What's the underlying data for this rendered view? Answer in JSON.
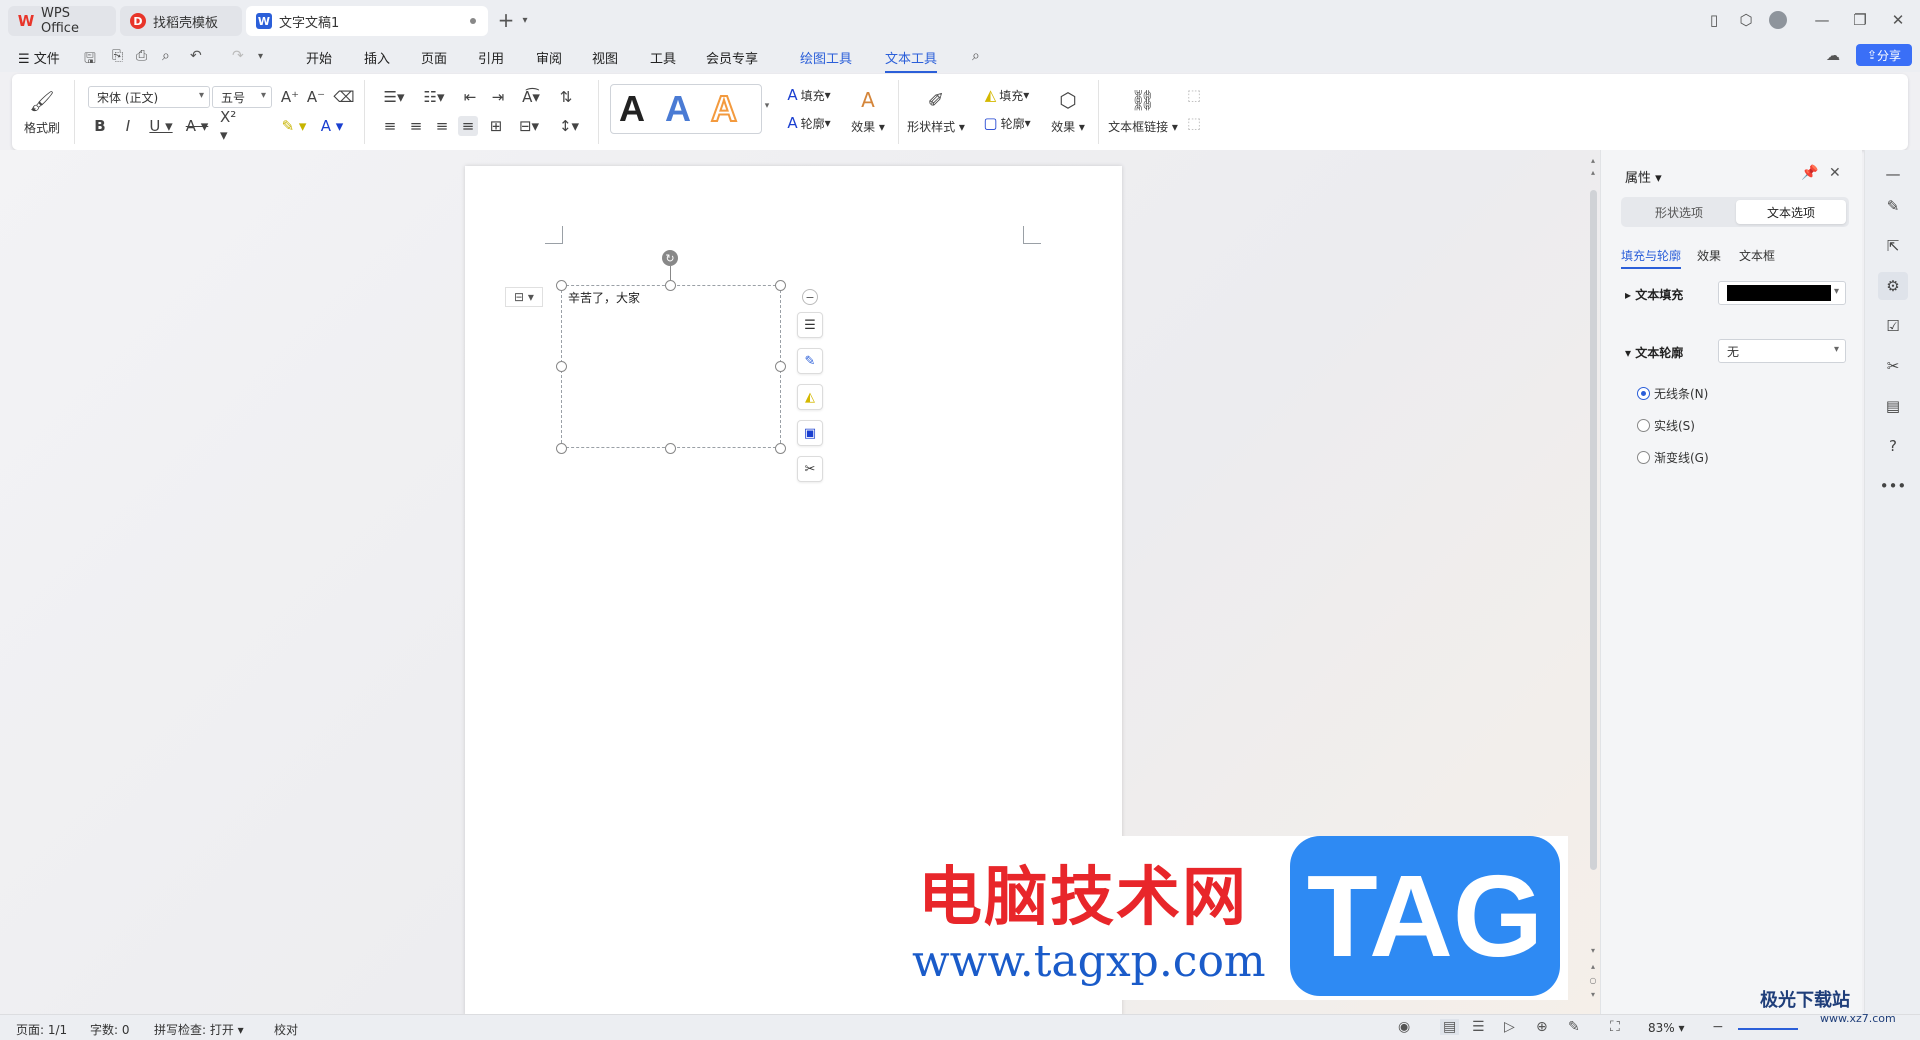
{
  "titlebar": {
    "tabs": [
      {
        "label": "WPS Office"
      },
      {
        "label": "找稻壳模板"
      },
      {
        "label": "文字文稿1"
      }
    ]
  },
  "menubar": {
    "file_label": "文件",
    "items": [
      "开始",
      "插入",
      "页面",
      "引用",
      "审阅",
      "视图",
      "工具",
      "会员专享",
      "绘图工具",
      "文本工具"
    ],
    "active_item": "文本工具",
    "share_label": "分享"
  },
  "ribbon": {
    "format_painter_label": "格式刷",
    "font_name": "宋体 (正文)",
    "font_size": "五号",
    "fill_label": "填充",
    "outline_label": "轮廓",
    "effect_label": "效果",
    "shape_style_label": "形状样式",
    "shape_fill_label": "填充",
    "shape_outline_label": "轮廓",
    "shape_effect_label": "效果",
    "textbox_link_label": "文本框链接",
    "art_styles": [
      {
        "glyph": "A",
        "color": "#000000"
      },
      {
        "glyph": "A",
        "color": "#4a7bd4"
      },
      {
        "glyph": "A",
        "color": "#f39a3e"
      }
    ]
  },
  "document": {
    "textbox_text": "辛苦了，大家"
  },
  "panel": {
    "title": "属性",
    "segments": [
      "形状选项",
      "文本选项"
    ],
    "active_segment": "文本选项",
    "subtabs": [
      "填充与轮廓",
      "效果",
      "文本框"
    ],
    "active_subtab": "填充与轮廓",
    "text_fill_label": "文本填充",
    "text_fill_color": "#000000",
    "text_outline_label": "文本轮廓",
    "text_outline_value": "无",
    "line_options": [
      {
        "label": "无线条(N)",
        "selected": true
      },
      {
        "label": "实线(S)",
        "selected": false
      },
      {
        "label": "渐变线(G)",
        "selected": false
      }
    ]
  },
  "statusbar": {
    "page": "页面: 1/1",
    "words": "字数: 0",
    "spellcheck": "拼写检查: 打开",
    "proof": "校对",
    "zoom": "83%"
  },
  "watermark": {
    "cn_text": "电脑技术网",
    "url": "www.tagxp.com",
    "tag": "TAG",
    "corner_text": "极光下载站",
    "corner_url": "www.xz7.com"
  },
  "colors": {
    "accent": "#2b5fd9",
    "share_bg": "#3a6ff7",
    "wps_red": "#e8352a"
  }
}
